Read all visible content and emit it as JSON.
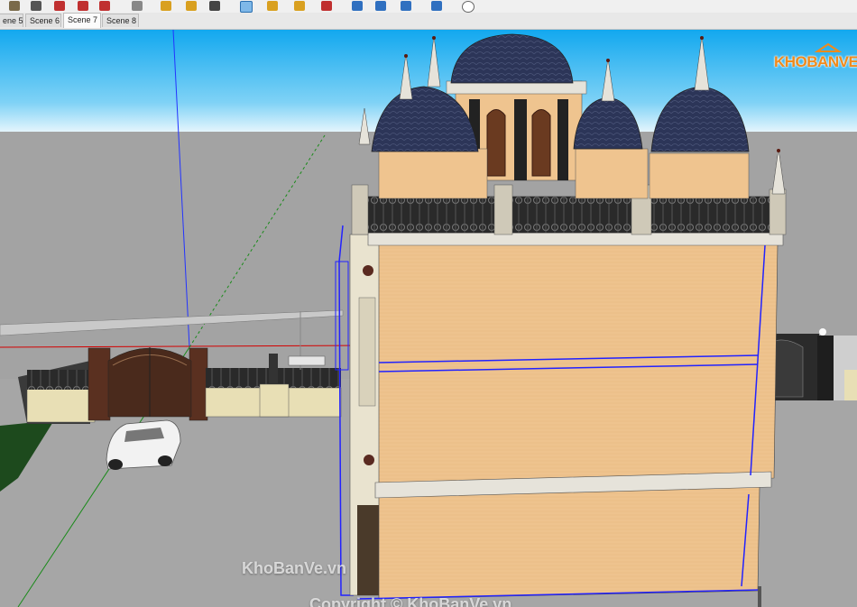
{
  "scene_tabs": [
    {
      "label": "ene 5",
      "active": false
    },
    {
      "label": "Scene 6",
      "active": false
    },
    {
      "label": "Scene 7",
      "active": true
    },
    {
      "label": "Scene 8",
      "active": false
    }
  ],
  "toolbar_icons": [
    "paint-bucket-icon",
    "eraser-icon",
    "move-icon",
    "rotate-icon",
    "tape-measure-icon",
    "pencil-icon",
    "orbit-icon",
    "pan-icon",
    "zoom-icon",
    "zoom-extents-icon",
    "section-icon",
    "sandbox-icon",
    "shadow-icon"
  ],
  "logo": {
    "text": "KHOBANVE"
  },
  "watermarks": {
    "site": "KhoBanVe.vn",
    "copyright": "Copyright © KhoBanVe.vn"
  },
  "colors": {
    "sky": "#18b0f0",
    "ground": "#a3a3a3",
    "wall": "#efc48f",
    "dome": "#2c3558",
    "selection": "#2222ff",
    "axis_red": "#d40000",
    "axis_green": "#1a8a1a"
  }
}
